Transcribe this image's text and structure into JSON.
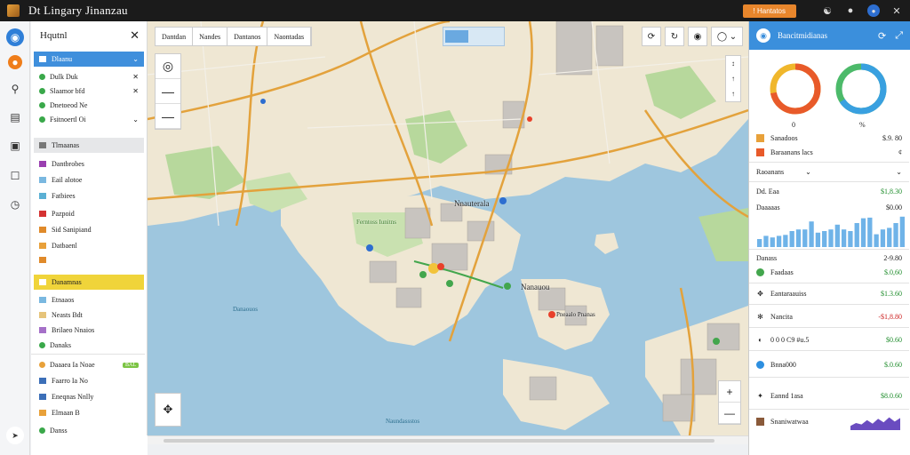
{
  "app": {
    "title": "Dt  Lingary Jinanzau",
    "action_button": "! Hantatos"
  },
  "colors": {
    "accent": "#3b8fdc",
    "alert": "#e8862c",
    "water": "#9ec6de",
    "land": "#f1ead8",
    "park": "#b7d89c",
    "road": "#e3a23c"
  },
  "rail": [
    "globe-icon",
    "record-icon",
    "pin-icon",
    "chart-icon",
    "layers-icon",
    "comment-icon",
    "clock-icon"
  ],
  "layer_panel": {
    "title": "Hqutnl",
    "groups": [
      {
        "label": "Dlaanu",
        "items": [
          "Dulk Duk",
          "Slaamor bfd",
          "Dnetoeod Ne",
          "Fsitnoertl Oi"
        ]
      },
      {
        "label": "Tlmaanas",
        "items": [
          "Dantbrobes",
          "Eail alotoe",
          "Fatbiees",
          "Pazpoid",
          "Sid Sanipiand",
          "Datbaenl"
        ]
      },
      {
        "label": "Danamnas",
        "items": [
          "Etnaaos",
          "Neasts Bdt",
          "Brilaeo Nnaios",
          "Danaks"
        ]
      }
    ],
    "footer": {
      "label": "Daaaea Ia Noae",
      "badge": "BAL",
      "items": [
        "Faarro Ia No",
        "Eneqnas Nnlly",
        "Elmaan B"
      ],
      "bottom": "Danss"
    }
  },
  "map": {
    "tabs": [
      "Dantdan",
      "Nandes",
      "Dantanos",
      "Naontadas"
    ],
    "labels": {
      "district": "Nnauterala",
      "city": "Nanauou",
      "bay": "Ferntoss Iunitns",
      "river": "Danaouos",
      "harbor": "Pneaalo Pnanas",
      "channel": "Naundassstos"
    }
  },
  "stats_panel": {
    "title": "Bancitmidianas",
    "donut_labels": [
      "0",
      "%"
    ],
    "donuts": [
      {
        "value": 0.72,
        "primary": "#e85a2a",
        "secondary": "#f0b72c"
      },
      {
        "value": 0.66,
        "primary": "#39a0e0",
        "secondary": "#4cba6a"
      }
    ],
    "kpis": [
      {
        "label": "Sanadoos",
        "value": "$.9. 80"
      },
      {
        "label": "Baraanans lacs",
        "value": "¢"
      }
    ],
    "dropdown": "Raoanans",
    "summary": [
      {
        "label": "Dd. Eaa",
        "value": "$1,8.30"
      },
      {
        "label": "Daaaaas",
        "value": "$0.00"
      }
    ],
    "bars": [
      0.25,
      0.35,
      0.3,
      0.35,
      0.38,
      0.5,
      0.55,
      0.55,
      0.8,
      0.45,
      0.5,
      0.55,
      0.7,
      0.55,
      0.5,
      0.75,
      0.9,
      0.92,
      0.4,
      0.55,
      0.6,
      0.75,
      0.95
    ],
    "list_header": {
      "label": "Danass",
      "value": "2-9.80"
    },
    "list": [
      {
        "label": "Faadaas",
        "value": "$.0,60",
        "tone": "green",
        "icon": "green-dot-icon"
      },
      {
        "label": "Eantaraauiss",
        "value": "$1.3.60",
        "tone": "green",
        "icon": "arrows-icon"
      },
      {
        "label": "Nancita",
        "value": "-$1,8.80",
        "tone": "red",
        "icon": "hub-icon"
      },
      {
        "label": "0 0 0 C9 #u.5",
        "value": "$0.60",
        "tone": "green",
        "icon": "gauge-icon"
      },
      {
        "label": "Bnna000",
        "value": "$.0.60",
        "tone": "green",
        "icon": "blue-dot-icon"
      },
      {
        "label": "Eannd 1asa",
        "value": "$8.0.60",
        "tone": "green",
        "icon": "network-icon"
      },
      {
        "label": "Snaniwatwaa",
        "value": "",
        "tone": "green",
        "icon": "cube-icon"
      }
    ],
    "sparkline": [
      0.3,
      0.5,
      0.4,
      0.7,
      0.45,
      0.8,
      0.55,
      0.9,
      0.6,
      0.85
    ]
  }
}
